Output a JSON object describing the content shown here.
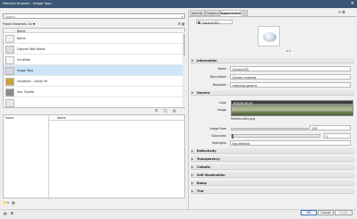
{
  "window": {
    "title": "Material Browser - Image Tops",
    "close_glyph": "✕"
  },
  "left": {
    "search": {
      "placeholder": "Search",
      "icon": "search-icon",
      "icon_glyph": "⌕"
    },
    "library_selector": "Project Materials: All ▼",
    "library_tools": "☰ ◧",
    "list_header": "Name",
    "materials": [
      {
        "label": "Name",
        "swatch": "#f1f1f1",
        "selected": false
      },
      {
        "label": "Gypsum Wall Board",
        "swatch": "#dedede",
        "selected": false
      },
      {
        "label": "Ice White",
        "swatch": "#f4f6f8",
        "selected": false
      },
      {
        "label": "Image Tops",
        "swatch": "#d6d6d6",
        "selected": true
      },
      {
        "label": "Insulation - Cavity Fill",
        "swatch": "#c9a23a",
        "selected": false
      },
      {
        "label": "Iron, Ductile",
        "swatch": "#8a8a8a",
        "selected": false
      },
      {
        "label": "",
        "swatch": "#e9e9e9",
        "selected": false
      }
    ],
    "mid_tools": [
      "☰",
      "◫",
      "▤"
    ],
    "library_tree": {
      "home_label": "Home",
      "name_header": "Name"
    },
    "bottom_tools": [
      "📁",
      "▾",
      "▦"
    ]
  },
  "right": {
    "tabs": [
      "Identity",
      "Graphics",
      "Appearance",
      "+"
    ],
    "active_tab": 2,
    "tools": "⟳ ⧉",
    "material_name": "Generic(93)",
    "preview_control": "⧈ ▾",
    "sections": {
      "information": "Information",
      "generic": "Generic",
      "reflectivity": "Reflectivity",
      "transparency": "Transparency",
      "cutouts": "Cutouts",
      "self_illumination": "Self Illumination",
      "bump": "Bump",
      "tint": "Tint"
    },
    "info": {
      "name_label": "Name",
      "name_value": "Generic(93)",
      "description_label": "Description",
      "description_value": "Generic material.",
      "keywords_label": "Keywords",
      "keywords_value": "materials,generic"
    },
    "generic": {
      "color_label": "Color",
      "color_value": "RGB 80 80 80",
      "image_label": "Image",
      "image_file": "Parkbrush64.png",
      "image_fade_label": "Image Fade",
      "image_fade_value": "100",
      "glossiness_label": "Glossiness",
      "glossiness_value": "0",
      "glossiness_fraction": 0,
      "highlights_label": "Highlights",
      "highlights_value": "Non-Metallic"
    }
  },
  "buttons": {
    "ok": "OK",
    "cancel": "Cancel",
    "apply": "Apply"
  },
  "corner_tools": [
    "▦",
    "⧉"
  ]
}
